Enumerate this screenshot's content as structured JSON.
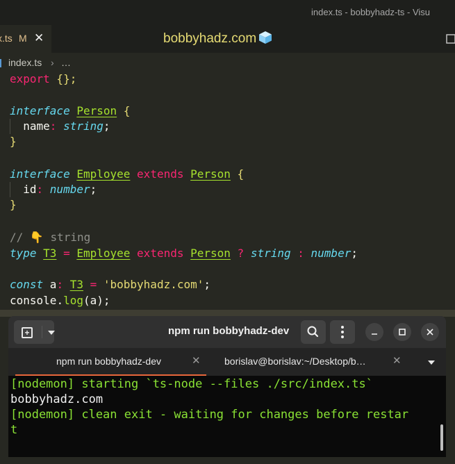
{
  "window": {
    "title": "index.ts - bobbyhadz-ts - Visu"
  },
  "tab": {
    "name": "x.ts",
    "modified": "M",
    "close": "✕"
  },
  "brand": {
    "text": "bobbyhadz.com",
    "icon": "cube-emoji"
  },
  "breadcrumb": {
    "file": "index.ts",
    "separator": "›",
    "more": "…"
  },
  "code": {
    "l1": {
      "kw": "export",
      "rest": " {};"
    },
    "l3": {
      "kw": "interface",
      "name": "Person",
      "brace": " {"
    },
    "l4": {
      "prop": "name",
      "colon": ": ",
      "type": "string",
      "semi": ";"
    },
    "l5": {
      "brace": "}"
    },
    "l7": {
      "kw": "interface",
      "name": "Employee",
      "ext": "extends",
      "base": "Person",
      "brace": " {"
    },
    "l8": {
      "prop": "id",
      "colon": ": ",
      "type": "number",
      "semi": ";"
    },
    "l9": {
      "brace": "}"
    },
    "l11": {
      "comment": "// ",
      "emoji": "👇",
      "text": " string"
    },
    "l12": {
      "kw": "type",
      "name": "T3",
      "eq": " = ",
      "emp": "Employee",
      "ext": "extends",
      "base": "Person",
      "q": " ? ",
      "t1": "string",
      "c": " : ",
      "t2": "number",
      "semi": ";"
    },
    "l14": {
      "kw": "const",
      "var": " a",
      "colon": ": ",
      "type": "T3",
      "eq": " = ",
      "str": "'bobbyhadz.com'",
      "semi": ";"
    },
    "l15": {
      "obj": "console",
      "dot": ".",
      "fn": "log",
      "args": "(a);"
    }
  },
  "terminal": {
    "title": "npm run bobbyhadz-dev",
    "tabs": [
      {
        "label": "npm run bobbyhadz-dev",
        "close": "✕"
      },
      {
        "label": "borislav@borislav:~/Desktop/b…",
        "close": "✕"
      }
    ],
    "lines": [
      "[nodemon] starting `ts-node --files ./src/index.ts`",
      "bobbyhadz.com",
      "[nodemon] clean exit - waiting for changes before restar",
      "t"
    ],
    "colors": {
      "nodemon": "#8ae234",
      "output": "#f0f0f0",
      "active_tab_underline": "#e8663b"
    }
  },
  "theme": {
    "editor_bg": "#272822",
    "keyword": "#f92672",
    "type": "#66d9ef",
    "class": "#a6e22e",
    "string": "#e6db74"
  }
}
